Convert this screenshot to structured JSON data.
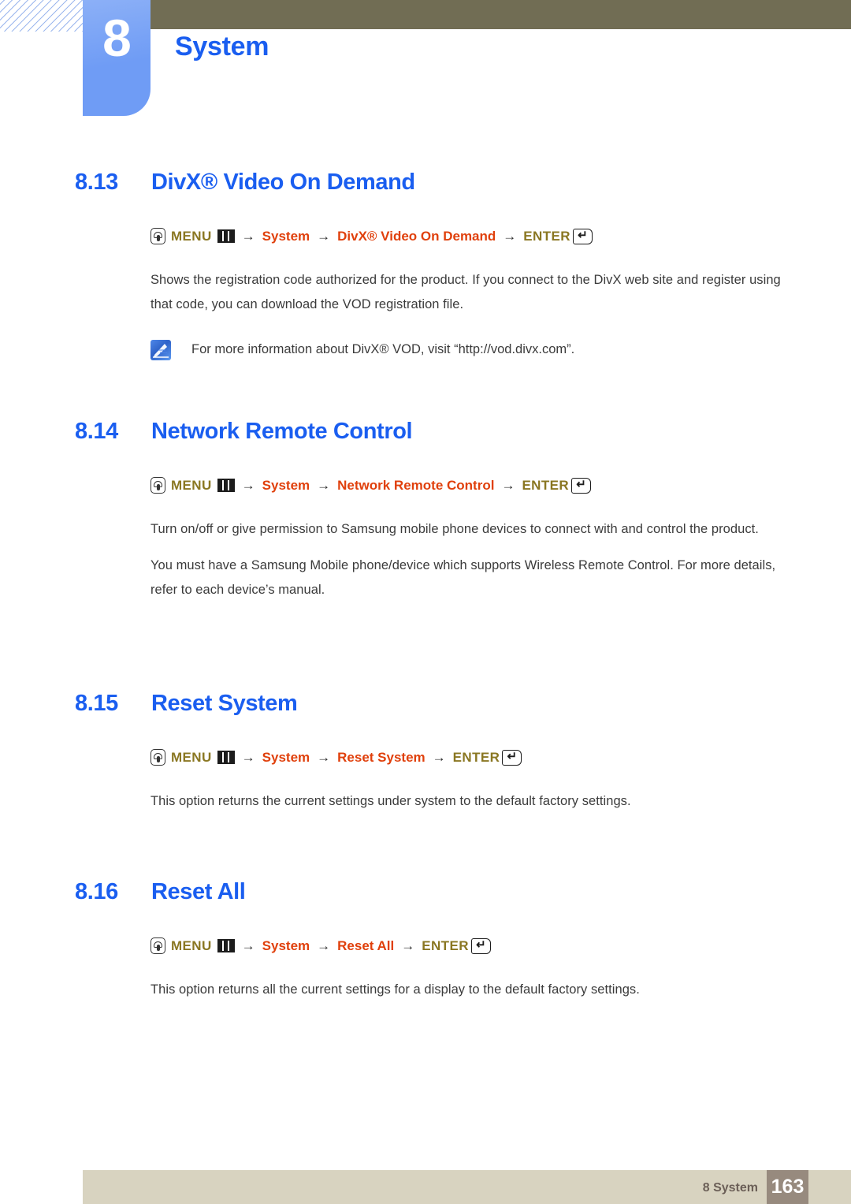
{
  "header": {
    "chapter_number": "8",
    "chapter_title": "System",
    "hatch_color": "#7b9fe8",
    "olive_bar_color": "#716d54",
    "tab_color": "#6f9cf5",
    "heading_color": "#1a5ef0"
  },
  "icons": {
    "hand": "hand-press-icon",
    "grid": "menu-grid-icon",
    "enter": "enter-key-icon",
    "enter_glyph": "↵",
    "note": "note-pen-icon"
  },
  "menu_path_labels": {
    "menu": "MENU",
    "enter": "ENTER",
    "arrow": "→"
  },
  "sections": [
    {
      "number": "8.13",
      "name": "DivX® Video On Demand",
      "path": [
        "System",
        "DivX® Video On Demand"
      ],
      "paragraphs": [
        "Shows the registration code authorized for the product. If you connect to the DivX web site and register using that code, you can download the VOD registration file."
      ],
      "note": "For more information about DivX® VOD, visit “http://vod.divx.com”."
    },
    {
      "number": "8.14",
      "name": "Network Remote Control",
      "path": [
        "System",
        "Network Remote Control"
      ],
      "paragraphs": [
        "Turn on/off or give permission to Samsung mobile phone devices to connect with and control the product.",
        "You must have a Samsung Mobile phone/device which supports Wireless Remote Control. For more details, refer to each device’s manual."
      ]
    },
    {
      "number": "8.15",
      "name": "Reset System",
      "path": [
        "System",
        "Reset System"
      ],
      "paragraphs": [
        "This option returns the current settings under system to the default factory settings."
      ]
    },
    {
      "number": "8.16",
      "name": "Reset All",
      "path": [
        "System",
        "Reset All"
      ],
      "paragraphs": [
        "This option returns all the current settings for a display to the default factory settings."
      ]
    }
  ],
  "footer": {
    "label": "8 System",
    "page": "163",
    "bar_color": "#d8d3c0",
    "page_box_color": "#978a7e"
  }
}
